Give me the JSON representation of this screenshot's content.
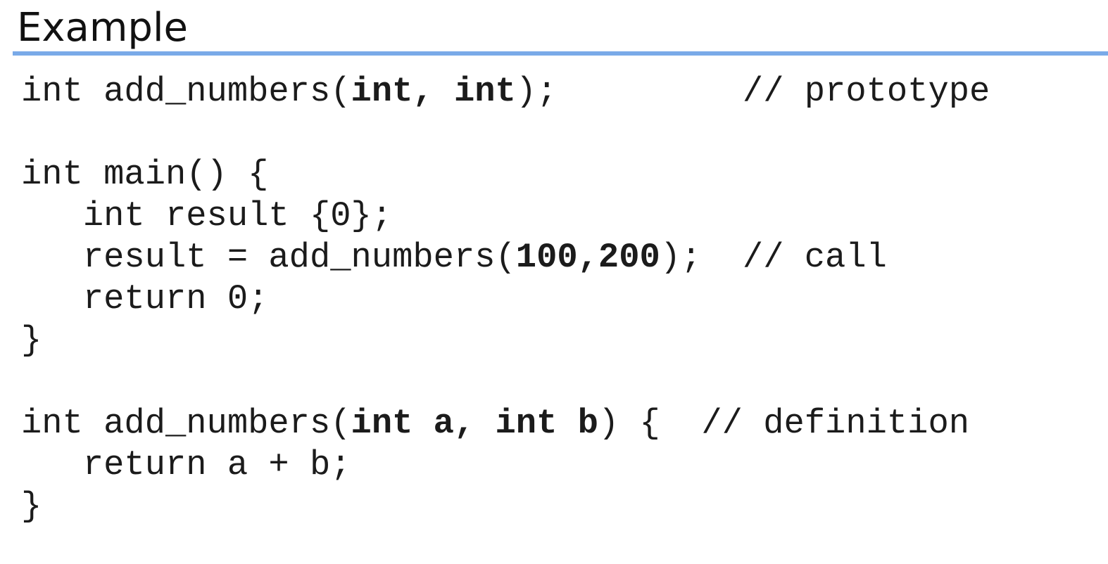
{
  "slide": {
    "title": "Example",
    "accent_color": "#7aaae8",
    "code_lines": [
      [
        {
          "t": "int add_numbers("
        },
        {
          "t": "int, int",
          "b": true
        },
        {
          "t": ");         // prototype"
        }
      ],
      [],
      [
        {
          "t": "int main() {"
        }
      ],
      [
        {
          "t": "   int result {0};"
        }
      ],
      [
        {
          "t": "   result = add_numbers("
        },
        {
          "t": "100,200",
          "b": true
        },
        {
          "t": ");  // call"
        }
      ],
      [
        {
          "t": "   return 0;"
        }
      ],
      [
        {
          "t": "}"
        }
      ],
      [],
      [
        {
          "t": "int add_numbers("
        },
        {
          "t": "int a, int b",
          "b": true
        },
        {
          "t": ") {  // definition"
        }
      ],
      [
        {
          "t": "   return a + b;"
        }
      ],
      [
        {
          "t": "}"
        }
      ]
    ]
  }
}
